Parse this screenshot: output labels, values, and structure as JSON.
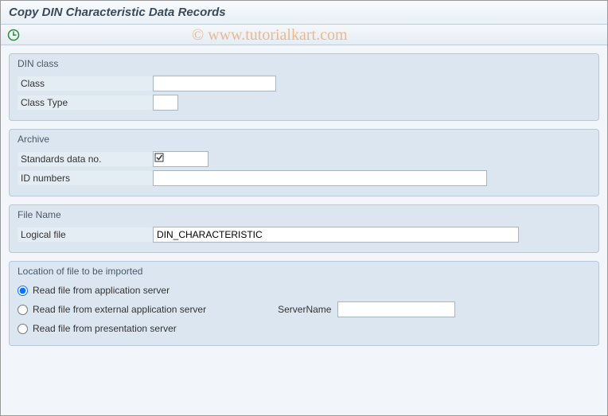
{
  "title": "Copy DIN Characteristic Data Records",
  "watermark": "© www.tutorialkart.com",
  "groups": {
    "din_class": {
      "title": "DIN class",
      "class_label": "Class",
      "class_value": "",
      "class_type_label": "Class Type",
      "class_type_value": ""
    },
    "archive": {
      "title": "Archive",
      "std_label": "Standards data no.",
      "std_checked": true,
      "id_label": "ID numbers",
      "id_value": ""
    },
    "filename": {
      "title": "File Name",
      "logical_label": "Logical file",
      "logical_value": "DIN_CHARACTERISTIC"
    },
    "location": {
      "title": "Location of file to be imported",
      "opt_app": "Read file from application server",
      "opt_ext": "Read file from external application server",
      "opt_pres": "Read file from presentation server",
      "server_label": "ServerName",
      "server_value": ""
    }
  }
}
